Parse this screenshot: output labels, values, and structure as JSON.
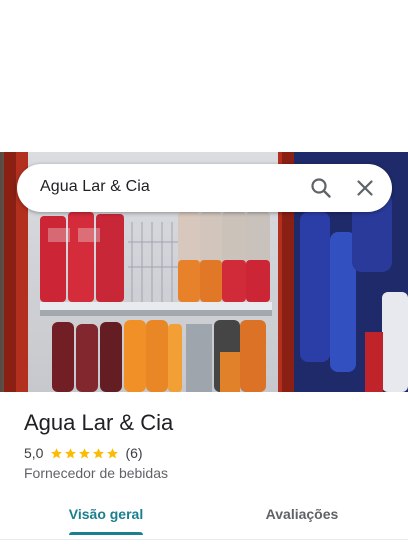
{
  "search": {
    "query": "Agua Lar & Cia"
  },
  "place": {
    "name": "Agua Lar & Cia",
    "rating": "5,0",
    "stars": 5,
    "review_count": "(6)",
    "category": "Fornecedor de bebidas"
  },
  "tabs": [
    {
      "label": "Visão geral",
      "active": true
    },
    {
      "label": "Avaliações",
      "active": false
    }
  ],
  "colors": {
    "accent": "#1a7f8e",
    "star": "#fbbc04",
    "title_text": "#202124",
    "secondary_text": "#5f6368"
  },
  "icons": {
    "search": "search-icon",
    "close": "close-icon",
    "star": "star-icon"
  }
}
